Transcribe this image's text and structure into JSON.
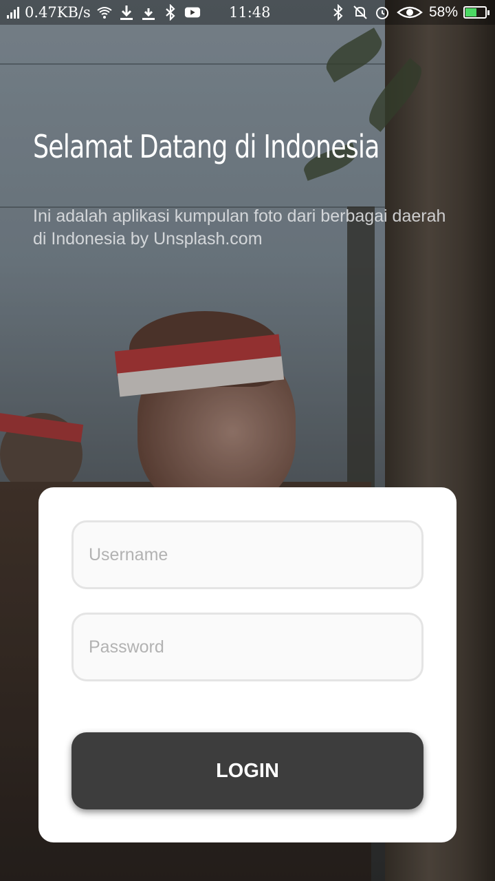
{
  "status_bar": {
    "network_speed": "0.47KB/s",
    "time": "11:48",
    "battery_percent": "58%",
    "battery_level": 0.58,
    "left_icons": [
      "signal-icon",
      "wifi-icon",
      "download-icon",
      "download-icon",
      "bluetooth-icon",
      "youtube-icon"
    ],
    "right_icons": [
      "bluetooth-icon",
      "mute-icon",
      "alarm-icon",
      "eye-icon",
      "battery-icon"
    ]
  },
  "welcome": {
    "title": "Selamat Datang di Indonesia",
    "subtitle": "Ini adalah aplikasi kumpulan foto dari berbagai daerah di Indonesia by Unsplash.com"
  },
  "login": {
    "username_placeholder": "Username",
    "password_placeholder": "Password",
    "login_label": "LOGIN"
  },
  "colors": {
    "card": "#ffffff",
    "button": "#3d3d3d",
    "battery_fill": "#4cd964"
  }
}
